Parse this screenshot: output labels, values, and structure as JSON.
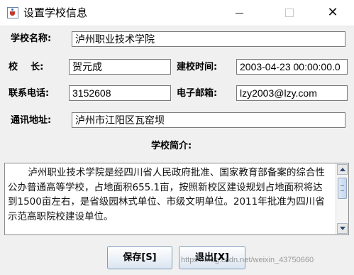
{
  "window": {
    "title": "设置学校信息",
    "controls": {
      "close": "✕"
    }
  },
  "form": {
    "school_name": {
      "label": "学校名称:",
      "value": "泸州职业技术学院"
    },
    "principal": {
      "label": "校    长:",
      "value": "贺元成"
    },
    "founded": {
      "label": "建校时间:",
      "value": "2003-04-23 00:00:00.0"
    },
    "phone": {
      "label": "联系电话:",
      "value": "3152608"
    },
    "email": {
      "label": "电子邮箱:",
      "value": "lzy2003@lzy.com"
    },
    "address": {
      "label": "通讯地址:",
      "value": "泸州市江阳区瓦窑坝"
    },
    "intro": {
      "label": "学校简介:",
      "value": "泸州职业技术学院是经四川省人民政府批准、国家教育部备案的综合性公办普通高等学校，占地面积655.1亩，按照新校区建设规划占地面积将达到1500亩左右，是省级园林式单位、市级文明单位。2011年批准为四川省示范高职院校建设单位。"
    }
  },
  "buttons": {
    "save": "保存[S]",
    "exit": "退出[X]"
  },
  "watermark": "https://blog.csdn.net/weixin_43750660",
  "icons": [
    "java-app-icon",
    "minimize-icon",
    "maximize-icon",
    "close-icon",
    "scroll-up-arrow-icon",
    "scroll-down-arrow-icon"
  ],
  "colors": {
    "button_border": "#7f9db9",
    "field_border": "#7a7a7a",
    "background": "#f0f0f0"
  }
}
